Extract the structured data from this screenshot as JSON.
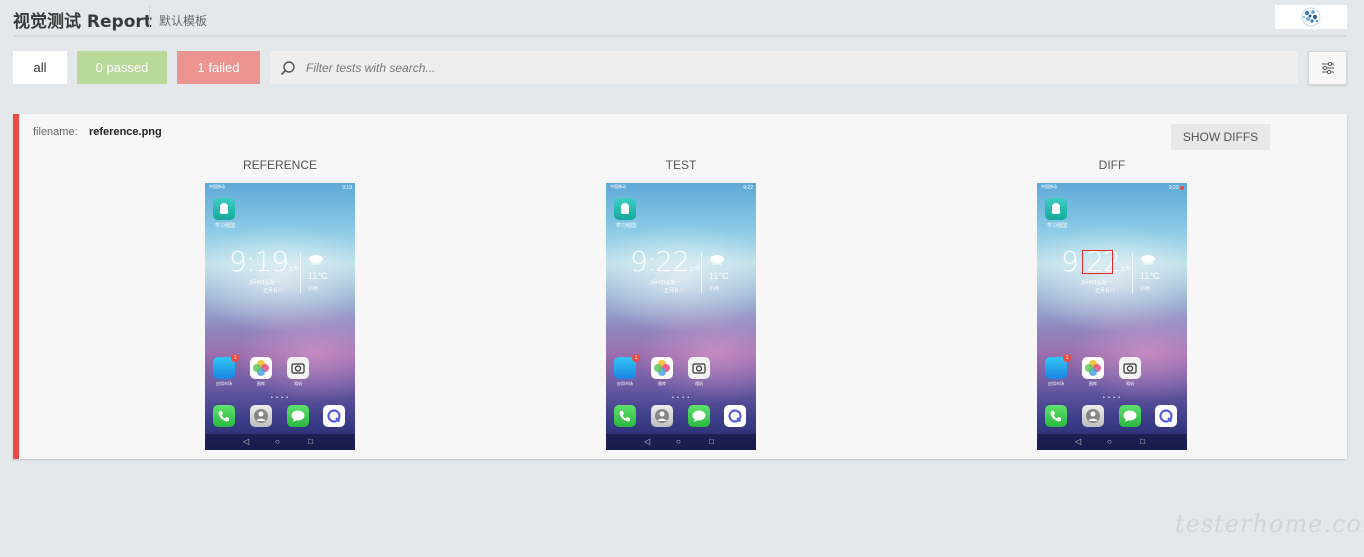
{
  "header": {
    "title": "视觉测试 Report",
    "subtitle": "默认模板",
    "logo_icon": "globe-logo-icon"
  },
  "toolbar": {
    "all_label": "all",
    "passed_label": "0 passed",
    "failed_label": "1 failed",
    "search_placeholder": "Filter tests with search...",
    "search_icon": "search-icon",
    "settings_icon": "sliders-icon"
  },
  "result": {
    "status": "failed",
    "filename_label": "filename:",
    "filename": "reference.png",
    "show_diffs_label": "SHOW DIFFS",
    "columns": [
      {
        "label": "REFERENCE",
        "clock": "9:19"
      },
      {
        "label": "TEST",
        "clock": "9:22"
      },
      {
        "label": "DIFF",
        "clock": "9:22"
      }
    ]
  },
  "phone": {
    "carrier": "中国移动",
    "status_time": "9:19",
    "ampm": "上午",
    "date": "3月4日星期一",
    "lunar": "正月廿八",
    "temp": "11°C",
    "weather_desc": "小雨",
    "top_app_label": "学习强国",
    "badge_count": "1",
    "apps": [
      {
        "label": "应用市场"
      },
      {
        "label": "图库"
      },
      {
        "label": "相机"
      }
    ]
  },
  "colors": {
    "passed": "#b9d99a",
    "failed": "#ec9590",
    "fail_border": "#ef4a43"
  },
  "watermark": "testerhome.com"
}
